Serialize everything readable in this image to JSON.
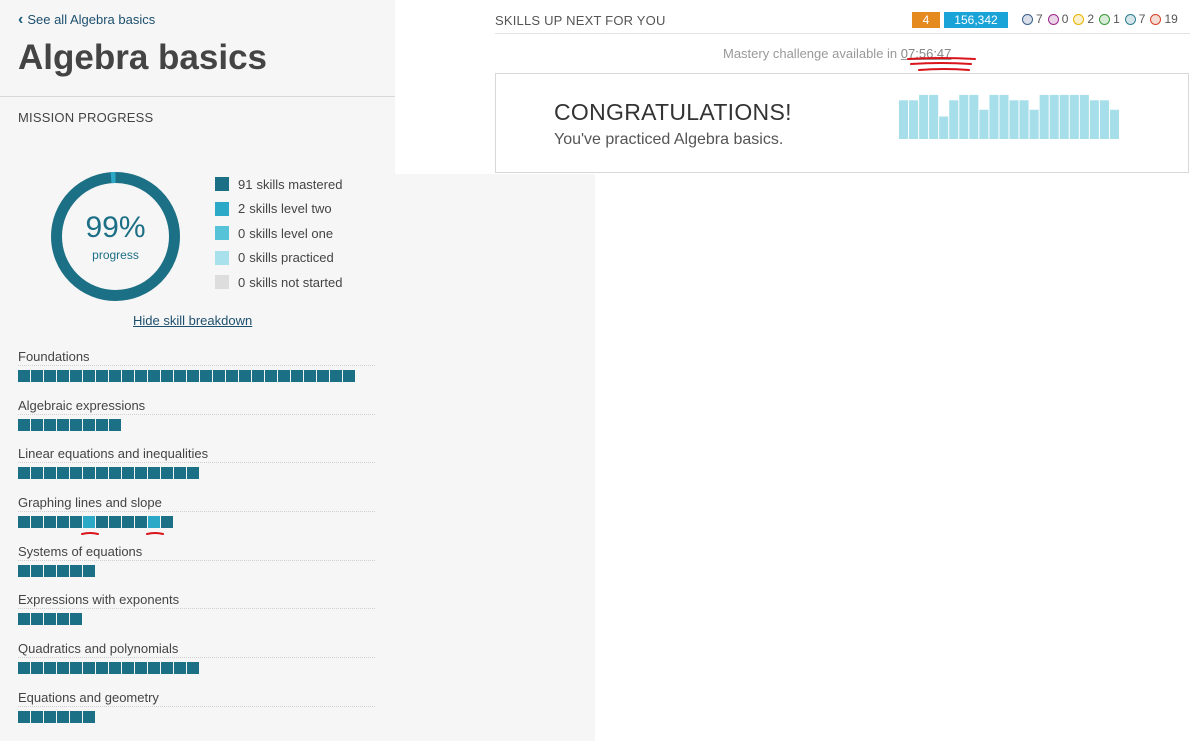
{
  "nav": {
    "back_label": "See all Algebra basics"
  },
  "page": {
    "title": "Algebra basics"
  },
  "mission": {
    "label": "MISSION PROGRESS",
    "progress_text": "99%",
    "progress_value": 0.99,
    "progress_sub": "progress",
    "legend": [
      {
        "count": "91",
        "label": "skills mastered",
        "color": "#1c7085"
      },
      {
        "count": "2",
        "label": "skills level two",
        "color": "#2ba9c6"
      },
      {
        "count": "0",
        "label": "skills level one",
        "color": "#57c3d8"
      },
      {
        "count": "0",
        "label": "skills practiced",
        "color": "#a8e0ec"
      },
      {
        "count": "0",
        "label": "skills not started",
        "color": "#dddddd"
      }
    ],
    "hide_link": "Hide skill breakdown"
  },
  "colors": {
    "mastered": "#1c7085",
    "level_two": "#2ba9c6",
    "annotation": "#d9141b"
  },
  "sections": [
    {
      "name": "Foundations",
      "blocks": "mmmmmmmmmmmmmmmmmmmmmmmmmm"
    },
    {
      "name": "Algebraic expressions",
      "blocks": "mmmmmmmm"
    },
    {
      "name": "Linear equations and inequalities",
      "blocks": "mmmmmmmmmmmmmm"
    },
    {
      "name": "Graphing lines and slope",
      "blocks": "mmmmmtmmmmtm"
    },
    {
      "name": "Systems of equations",
      "blocks": "mmmmmm"
    },
    {
      "name": "Expressions with exponents",
      "blocks": "mmmmm"
    },
    {
      "name": "Quadratics and polynomials",
      "blocks": "mmmmmmmmmmmmmm"
    },
    {
      "name": "Equations and geometry",
      "blocks": "mmmmmm"
    }
  ],
  "header": {
    "skills_label": "SKILLS UP NEXT FOR YOU",
    "streak": "4",
    "points": "156,342",
    "badges": [
      {
        "icon": "meteorite-badge-icon",
        "count": "7",
        "color": "#3b5f8c"
      },
      {
        "icon": "moon-badge-icon",
        "count": "0",
        "color": "#9b2a8a"
      },
      {
        "icon": "earth-badge-icon",
        "count": "2",
        "color": "#e6b400"
      },
      {
        "icon": "sun-badge-icon",
        "count": "1",
        "color": "#3a9a3a"
      },
      {
        "icon": "black-hole-badge-icon",
        "count": "7",
        "color": "#2d7f8f"
      },
      {
        "icon": "challenge-patch-icon",
        "count": "19",
        "color": "#d4442a"
      }
    ]
  },
  "mastery": {
    "prefix": "Mastery challenge available in ",
    "time": "07:56:47"
  },
  "congrats": {
    "title": "CONGRATULATIONS!",
    "subtitle": "You've practiced Algebra basics.",
    "bar_levels": [
      0.86,
      0.86,
      0.98,
      0.98,
      0.5,
      0.86,
      0.98,
      0.98,
      0.65,
      0.98,
      0.98,
      0.86,
      0.86,
      0.65,
      0.98,
      0.98,
      0.98,
      0.98,
      0.98,
      0.86,
      0.86,
      0.65
    ]
  }
}
